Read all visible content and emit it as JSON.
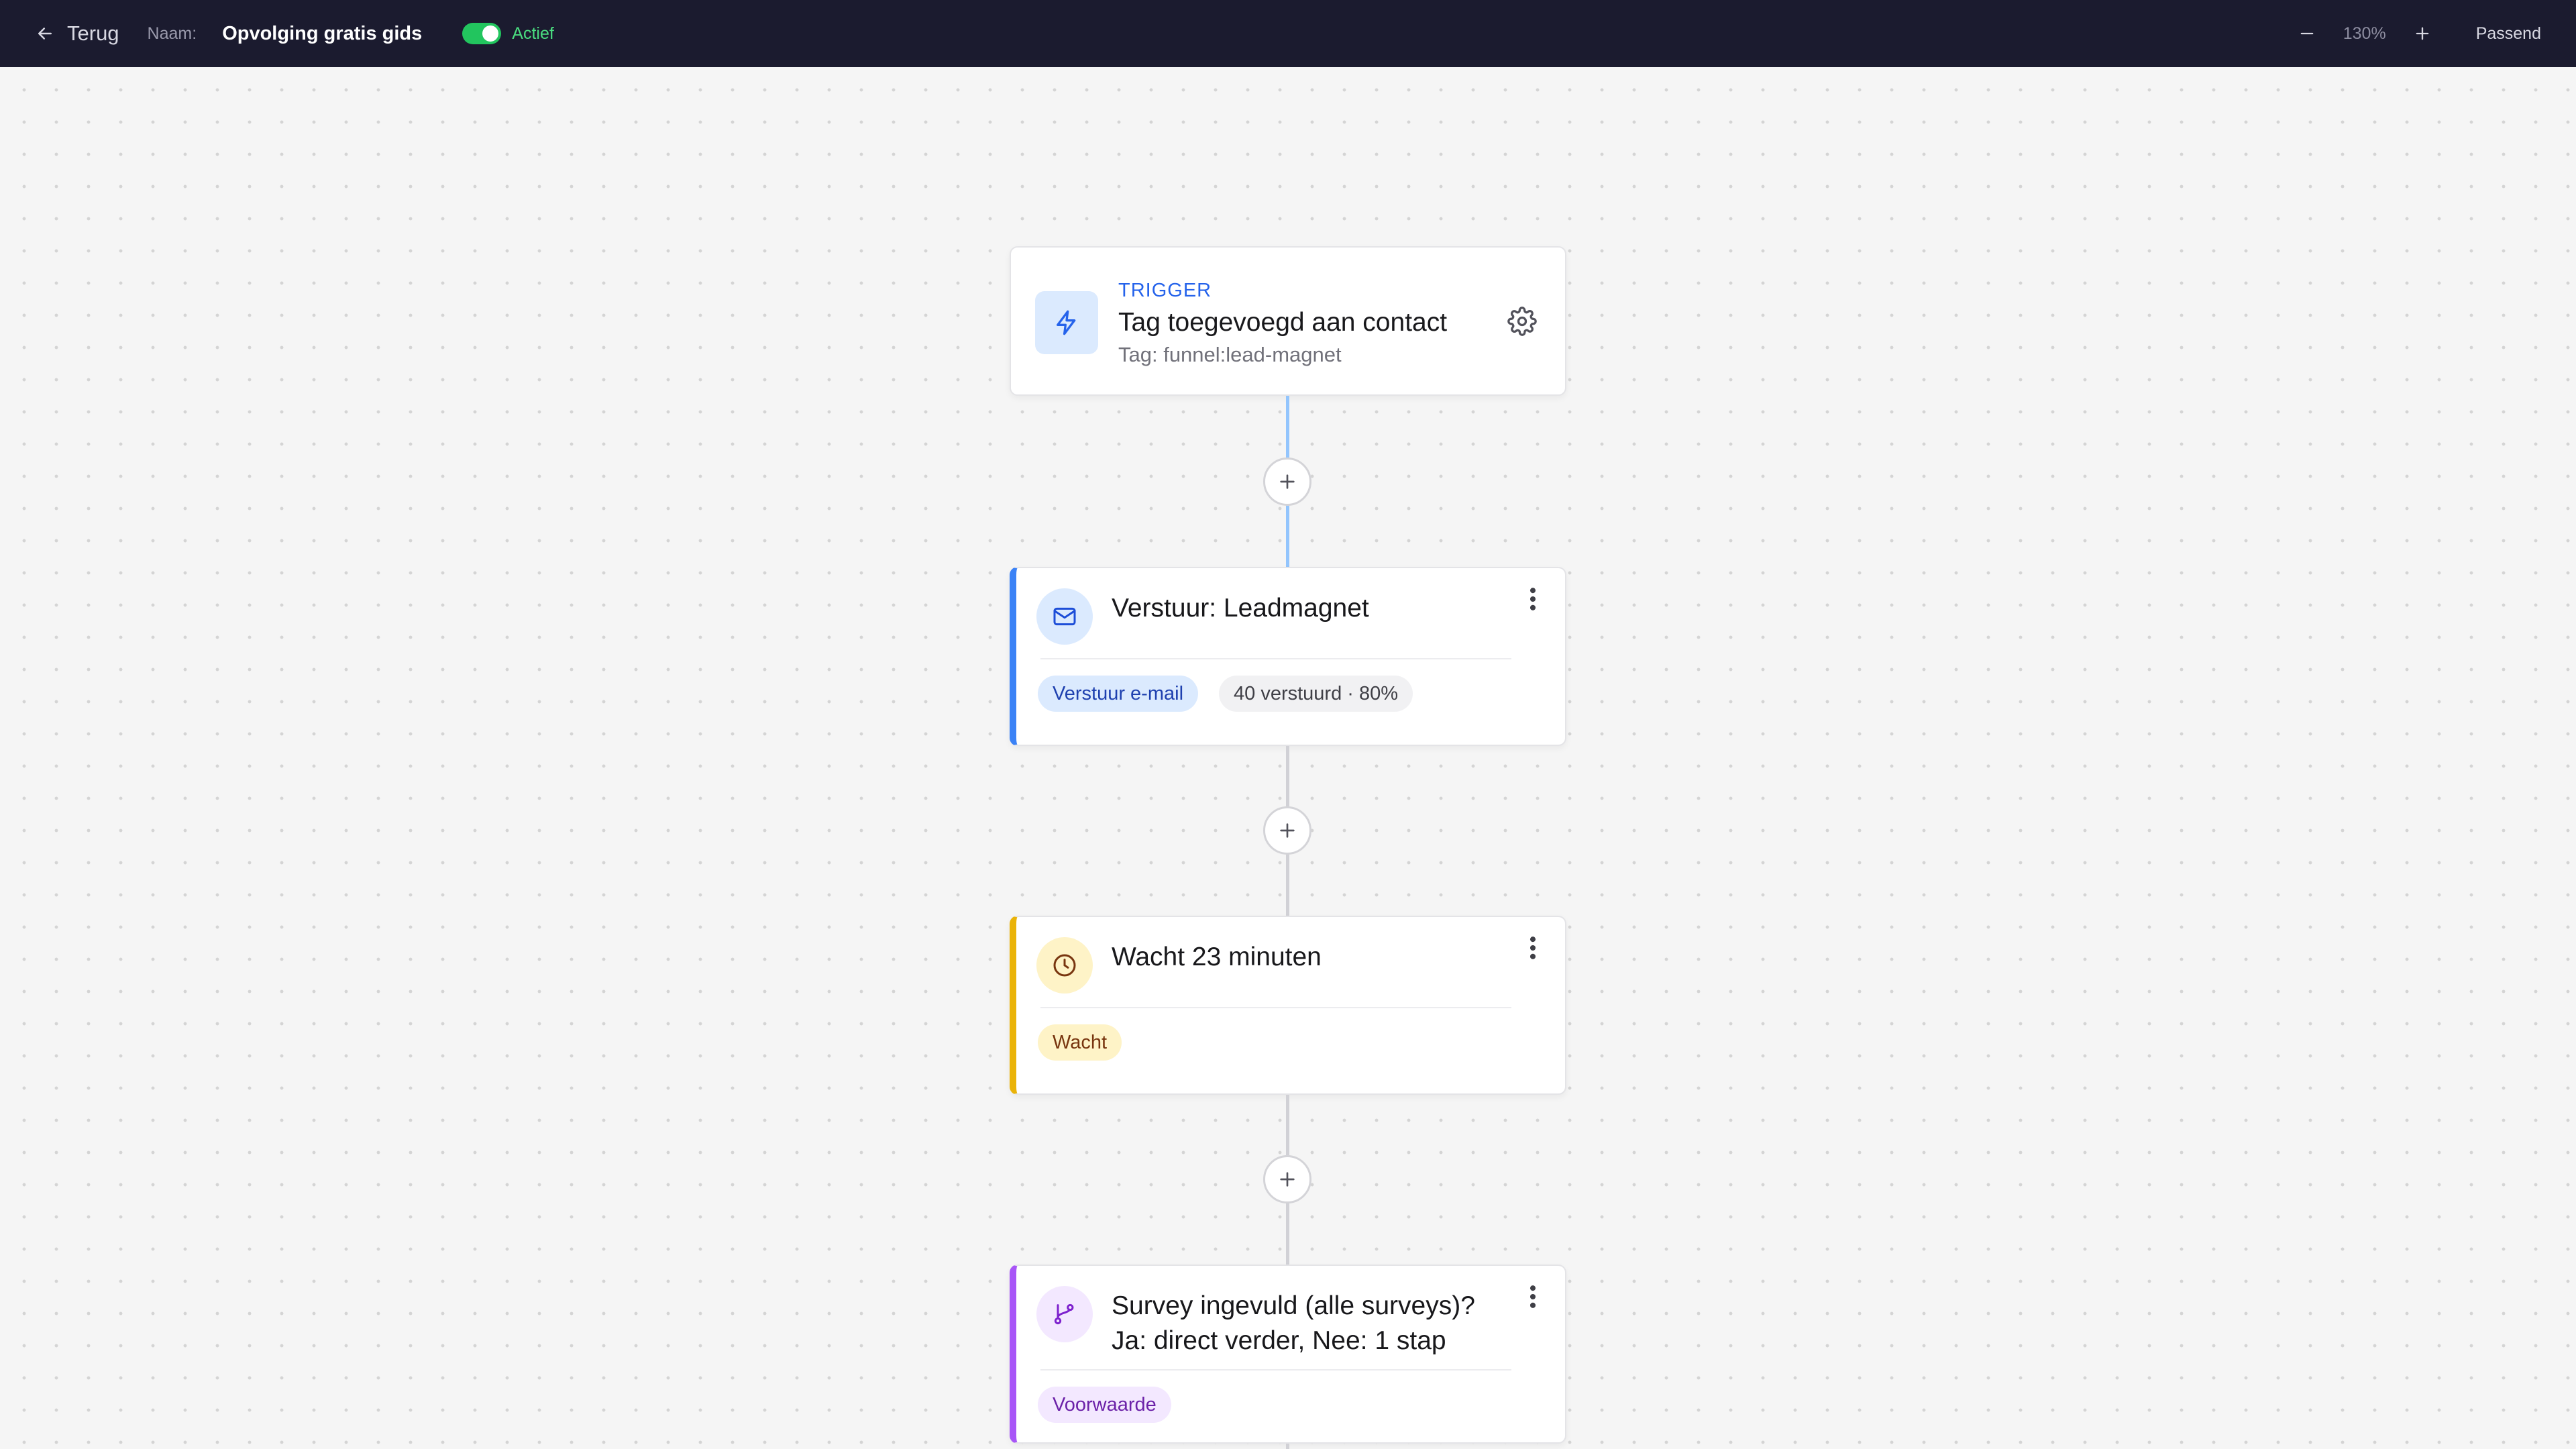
{
  "header": {
    "back_label": "Terug",
    "name_label": "Naam:",
    "flow_name": "Opvolging gratis gids",
    "status": "Actief",
    "zoom": "130%",
    "fit_label": "Passend"
  },
  "colors": {
    "topbar_bg": "#1b1b2f",
    "active_green": "#22c55e",
    "trigger_blue": "#2563eb",
    "email_blue": "#3b82f6",
    "wait_yellow": "#eab308",
    "condition_purple": "#a855f7"
  },
  "trigger": {
    "kicker": "TRIGGER",
    "title": "Tag toegevoegd aan contact",
    "subtitle": "Tag: funnel:lead-magnet",
    "icon": "lightning-icon",
    "settings_icon": "gear-icon"
  },
  "steps": [
    {
      "title": "Verstuur: Leadmagnet",
      "icon": "mail-icon",
      "badge": "Verstuur e-mail",
      "stats": "40 verstuurd · 80%"
    },
    {
      "title": "Wacht 23 minuten",
      "icon": "clock-icon",
      "badge": "Wacht"
    },
    {
      "title_line1": "Survey ingevuld (alle surveys)?",
      "title_line2": "Ja: direct verder, Nee: 1 stap",
      "icon": "branch-icon",
      "badge": "Voorwaarde"
    }
  ]
}
